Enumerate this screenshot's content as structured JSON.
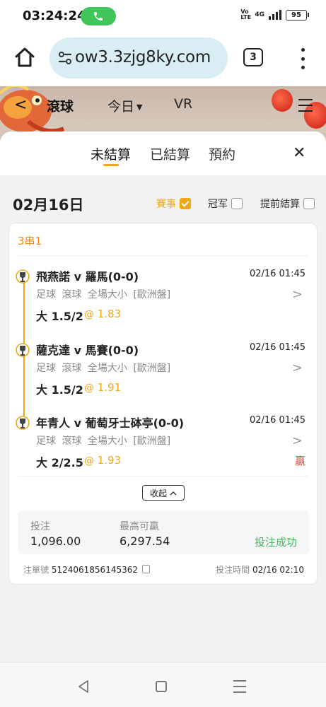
{
  "status_bar": {
    "time": "03:24:24",
    "network": "4G",
    "volte": "Vo LTE",
    "battery": "95"
  },
  "browser": {
    "url": "ow3.3zjg8ky.com",
    "tab_count": "3"
  },
  "app_header": {
    "back": "<",
    "title": "滾球",
    "today": "今日",
    "vr": "VR"
  },
  "sheet": {
    "tabs": [
      {
        "label": "未結算",
        "active": true
      },
      {
        "label": "已結算",
        "active": false
      },
      {
        "label": "預約",
        "active": false
      }
    ],
    "close": "✕",
    "date": "02月16日",
    "filters": [
      {
        "label": "賽事",
        "checked": true
      },
      {
        "label": "冠军",
        "checked": false
      },
      {
        "label": "提前結算",
        "checked": false
      }
    ]
  },
  "bet": {
    "type": "3串1",
    "legs": [
      {
        "match": "飛燕諾 v 羅馬(0-0)",
        "time": "02/16 01:45",
        "sub": "足球 滾球 全場大小 [歐洲盤]",
        "pick": "大 1.5/2",
        "odds": "@ 1.83",
        "result": ""
      },
      {
        "match": "薩克達 v 馬賽(0-0)",
        "time": "02/16 01:45",
        "sub": "足球 滾球 全場大小 [歐洲盤]",
        "pick": "大 1.5/2",
        "odds": "@ 1.91",
        "result": ""
      },
      {
        "match": "年青人 v 葡萄牙士砵亭(0-0)",
        "time": "02/16 01:45",
        "sub": "足球 滾球 全場大小 [歐洲盤]",
        "pick": "大 2/2.5",
        "odds": "@ 1.93",
        "result": "贏"
      }
    ],
    "collapse_label": "收起",
    "stake_label": "投注",
    "stake_value": "1,096.00",
    "max_win_label": "最高可贏",
    "max_win_value": "6,297.54",
    "status": "投注成功",
    "ticket_label": "注單號",
    "ticket_no": "5124061856145362",
    "bet_time_label": "投注時間",
    "bet_time": "02/16 02:10"
  },
  "colors": {
    "accent": "#f0a818",
    "success": "#47b35a",
    "win": "#e0493c",
    "parlay": "#e8891c"
  }
}
